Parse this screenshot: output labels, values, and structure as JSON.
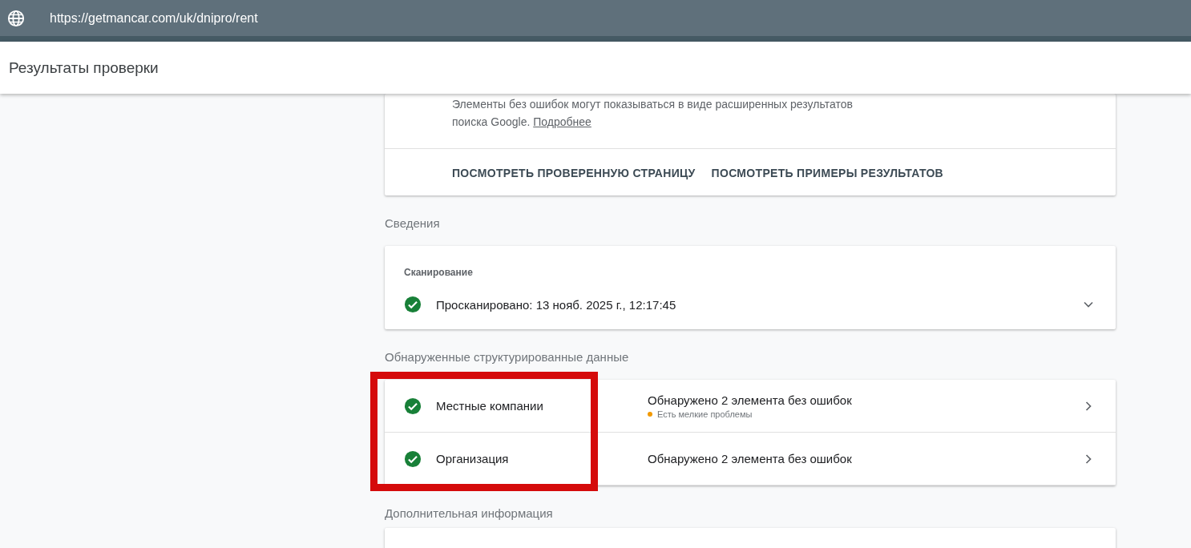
{
  "url_bar": {
    "url": "https://getmancar.com/uk/dnipro/rent"
  },
  "header": {
    "title": "Результаты проверки"
  },
  "result_card": {
    "description": "Элементы без ошибок могут показываться в виде расширенных результатов поиска Google.",
    "link": "Подробнее",
    "actions": [
      "ПОСМОТРЕТЬ ПРОВЕРЕННУЮ СТРАНИЦУ",
      "ПОСМОТРЕТЬ ПРИМЕРЫ РЕЗУЛЬТАТОВ"
    ]
  },
  "details": {
    "heading": "Сведения",
    "section_label": "Сканирование",
    "passed": true,
    "text": "Просканировано: 13 нояб. 2025 г., 12:17:45",
    "expanded": false
  },
  "structured_data": {
    "heading": "Обнаруженные структурированные данные",
    "highlighted": true,
    "rows": [
      {
        "name": "Местные компании",
        "passed": true,
        "summary": "Обнаружено 2 элемента без ошибок",
        "issue": {
          "text": "Есть мелкие проблемы",
          "color": "#f29900"
        }
      },
      {
        "name": "Организация",
        "passed": true,
        "summary": "Обнаружено 2 элемента без ошибок"
      }
    ]
  },
  "more_info": {
    "heading": "Дополнительная информация"
  }
}
